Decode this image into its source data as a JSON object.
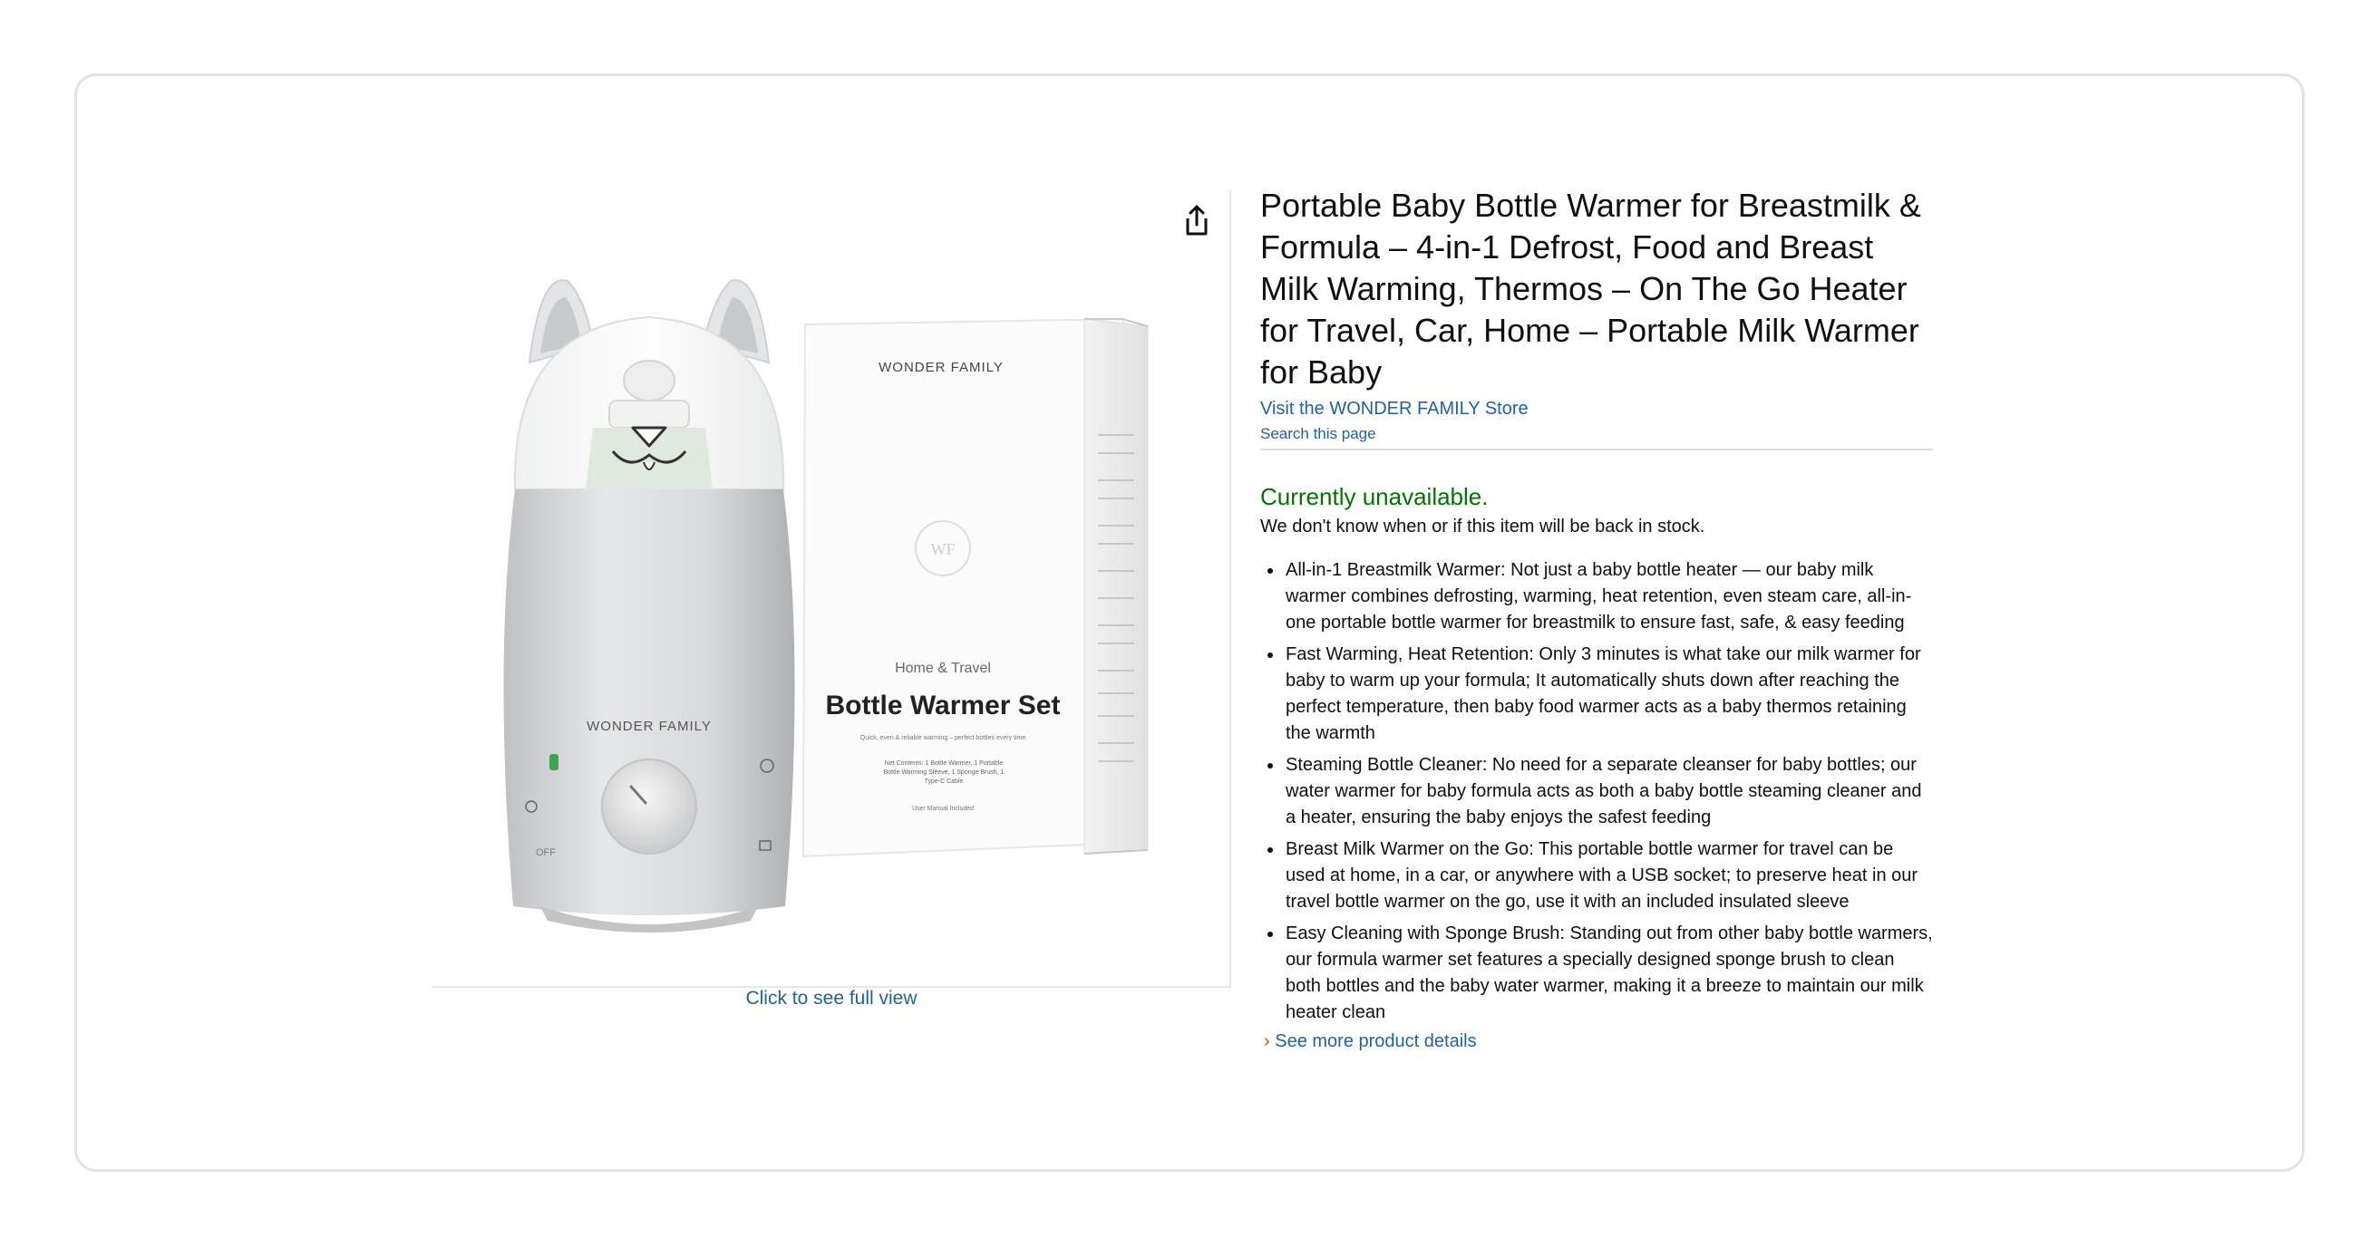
{
  "product": {
    "title": "Portable Baby Bottle Warmer for Breastmilk & Formula – 4-in-1 Defrost, Food and Breast Milk Warming, Thermos – On The Go Heater for Travel, Car, Home – Portable Milk Warmer for Baby",
    "store_link": "Visit the WONDER FAMILY Store",
    "search_page": "Search this page",
    "availability": "Currently unavailable.",
    "availability_note": "We don't know when or if this item will be back in stock.",
    "bullets": [
      "All-in-1 Breastmilk Warmer: Not just a baby bottle heater — our baby milk warmer combines defrosting, warming, heat retention, even steam care, all-in-one portable bottle warmer for breastmilk to ensure fast, safe, & easy feeding",
      "Fast Warming, Heat Retention: Only 3 minutes is what take our milk warmer for baby to warm up your formula; It automatically shuts down after reaching the perfect temperature, then baby food warmer acts as a baby thermos retaining the warmth",
      "Steaming Bottle Cleaner: No need for a separate cleanser for baby bottles; our water warmer for baby formula acts as both a baby bottle steaming cleaner and a heater, ensuring the baby enjoys the safest feeding",
      "Breast Milk Warmer on the Go: This portable bottle warmer for travel can be used at home, in a car, or anywhere with a USB socket; to preserve heat in our travel bottle warmer on the go, use it with an included insulated sleeve",
      "Easy Cleaning with Sponge Brush: Standing out from other baby bottle warmers, our formula warmer set features a specially designed sponge brush to clean both bottles and the baby water warmer, making it a breeze to maintain our milk heater clean"
    ],
    "see_more": "See more product details"
  },
  "gallery": {
    "full_view_label": "Click to see full view",
    "share_icon": "share-icon",
    "device_brand": "WONDER FAMILY",
    "device_off_label": "OFF",
    "box_brand": "WONDER FAMILY",
    "box_subtitle": "Home & Travel",
    "box_title": "Bottle Warmer Set",
    "box_tagline": "Quick, even & reliable warming – perfect bottles every time",
    "box_contents": "Net Contents: 1 Bottle Warmer, 1 Portable Bottle Warming Sleeve, 1 Sponge Brush, 1 Type-C Cable",
    "box_manual": "User Manual Included",
    "box_logo": "WF"
  },
  "colors": {
    "link": "#2162a1",
    "available": "#007600",
    "text": "#0f1111",
    "frame_border": "#e3e3e3"
  }
}
